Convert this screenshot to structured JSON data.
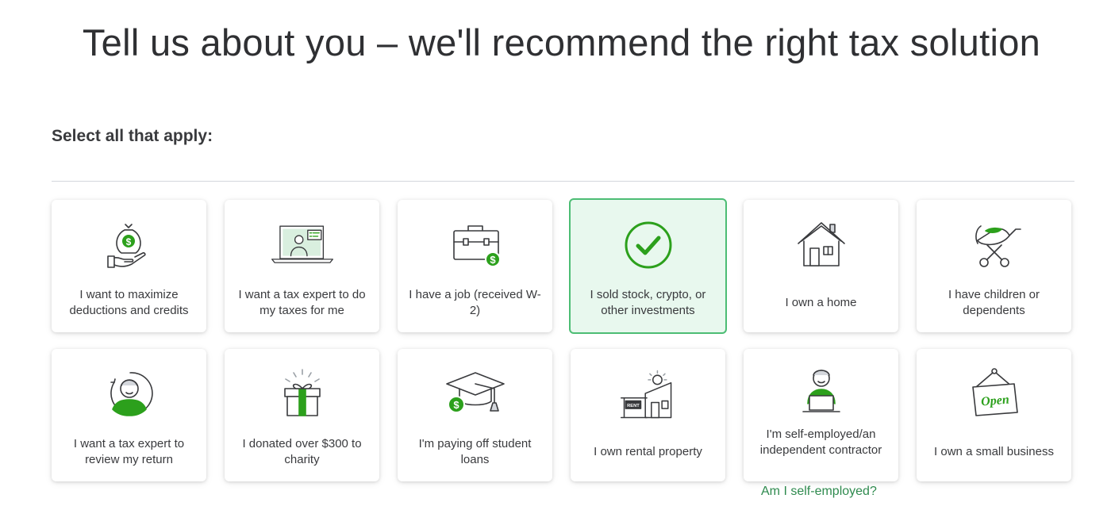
{
  "header": {
    "title": "Tell us about you – we'll recommend the right tax solution",
    "subtitle": "Select all that apply:"
  },
  "colors": {
    "accent": "#2ca01c",
    "selected_border": "#4cbd74",
    "selected_bg": "#e8f8ee",
    "link": "#2e8a4e"
  },
  "options": [
    {
      "label": "I want to maximize deductions and credits",
      "icon": "money-bag-hand-icon",
      "selected": false
    },
    {
      "label": "I want a tax expert to do my taxes for me",
      "icon": "laptop-expert-icon",
      "selected": false
    },
    {
      "label": "I have a job (received W-2)",
      "icon": "briefcase-dollar-icon",
      "selected": false
    },
    {
      "label": "I sold stock, crypto, or other investments",
      "icon": "check-circle-icon",
      "selected": true
    },
    {
      "label": "I own a home",
      "icon": "house-icon",
      "selected": false
    },
    {
      "label": "I have children or dependents",
      "icon": "stroller-icon",
      "selected": false
    },
    {
      "label": "I want a tax expert to review my return",
      "icon": "expert-avatar-icon",
      "selected": false
    },
    {
      "label": "I donated over $300 to charity",
      "icon": "gift-box-icon",
      "selected": false
    },
    {
      "label": "I'm paying off student loans",
      "icon": "graduation-cap-icon",
      "selected": false
    },
    {
      "label": "I own rental property",
      "icon": "rental-house-icon",
      "selected": false
    },
    {
      "label": "I'm self-employed/an independent contractor",
      "icon": "person-laptop-icon",
      "selected": false
    },
    {
      "label": "I own a small business",
      "icon": "open-sign-icon",
      "selected": false
    }
  ],
  "self_employed_link": "Am I self-employed?"
}
